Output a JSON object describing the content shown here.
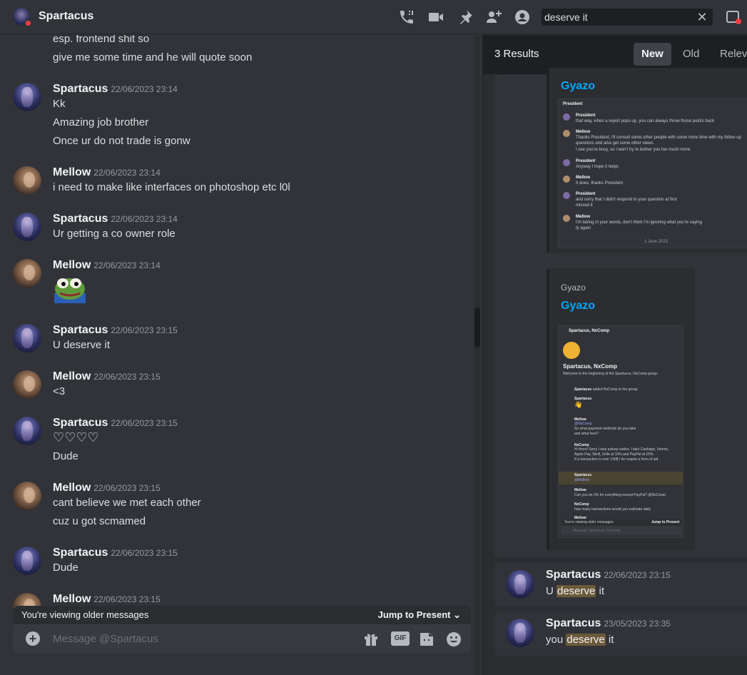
{
  "header": {
    "title": "Spartacus",
    "search_value": "deserve it",
    "clear_icon": "close-icon"
  },
  "chat": {
    "messages": [
      {
        "author": "",
        "time": "",
        "lines": [
          "esp. frontend shit so",
          "give me some time and he will quote soon"
        ]
      },
      {
        "author": "Spartacus",
        "time": "22/06/2023 23:14",
        "lines": [
          "Kk",
          "Amazing job brother",
          "Once ur do not trade is gonw"
        ]
      },
      {
        "author": "Mellow",
        "time": "22/06/2023 23:14",
        "lines": [
          "i need to make like interfaces on photoshop etc l0l"
        ]
      },
      {
        "author": "Spartacus",
        "time": "22/06/2023 23:14",
        "lines": [
          "Ur getting a co owner role"
        ]
      },
      {
        "author": "Mellow",
        "time": "22/06/2023 23:14",
        "lines": [],
        "emoji": "pepe-emoji"
      },
      {
        "author": "Spartacus",
        "time": "22/06/2023 23:15",
        "lines": [
          "U deserve it"
        ]
      },
      {
        "author": "Mellow",
        "time": "22/06/2023 23:15",
        "lines": [
          "<3"
        ]
      },
      {
        "author": "Spartacus",
        "time": "22/06/2023 23:15",
        "lines": [
          "♡♡♡♡",
          "Dude"
        ]
      },
      {
        "author": "Mellow",
        "time": "22/06/2023 23:15",
        "lines": [
          "cant believe we met each other",
          "cuz u got scmamed"
        ]
      },
      {
        "author": "Spartacus",
        "time": "22/06/2023 23:15",
        "lines": [
          "Dude"
        ]
      },
      {
        "author": "Mellow",
        "time": "22/06/2023 23:15",
        "lines": []
      }
    ],
    "older_notice": "You're viewing older messages",
    "jump_label": "Jump to Present",
    "composer_placeholder": "Message @Spartacus",
    "gif_label": "GIF"
  },
  "results": {
    "count": "3 Results",
    "tabs": [
      "New",
      "Old",
      "Relevant"
    ],
    "active_tab": "New",
    "embed1": {
      "title": "Gyazo",
      "thumb_header": "President",
      "thumb_lines": [
        {
          "name": "President",
          "text": "that way, when a report pops up, you can always throw those points back"
        },
        {
          "name": "Mellow",
          "text": "Thanks President, I'll consult some other people with some more time with my follow up"
        },
        {
          "name": "",
          "text": "questions and also get some other views."
        },
        {
          "name": "",
          "text": "I see you're busy, so I won't try to bother you too much more."
        },
        {
          "name": "President",
          "text": "Anyway I hope it helps"
        },
        {
          "name": "Mellow",
          "text": "It does, thanks President"
        },
        {
          "name": "President",
          "text": "and sorry that I didn't respond to your question at first"
        },
        {
          "name": "",
          "text": "missed it"
        },
        {
          "name": "Mellow",
          "text": "I'm taking in your words, don't think I'm ignoring what you're saying"
        },
        {
          "name": "",
          "text": "ty again"
        }
      ],
      "thumb_footer": "1 June 2023"
    },
    "embed2": {
      "provider": "Gyazo",
      "title": "Gyazo",
      "thumb_header": "Spartacus, NxComp",
      "thumb_group_title": "Spartacus, NxComp",
      "thumb_group_sub": "Welcome to the beginning of the Spartacus, NxComp group.",
      "thumb_lines": [
        {
          "name": "Spartacus",
          "text": "added NxComp to the group."
        },
        {
          "name": "Spartacus",
          "text": "👋"
        },
        {
          "name": "Mellow",
          "text": "@NxComp"
        },
        {
          "name": "",
          "text": "So what payment methods do you take"
        },
        {
          "name": "",
          "text": "and what fees?"
        },
        {
          "name": "NxComp",
          "text": "Hi there! Sorry I was asleep earlier. I take Cashapp, Venmo,"
        },
        {
          "name": "",
          "text": "Apple Pay, Skrill, Zelle at 10% and PayPal at 15%"
        },
        {
          "name": "",
          "text": "If a transaction is over 100$ I do require a form of aid"
        },
        {
          "name": "Spartacus",
          "text": "@Mellow"
        },
        {
          "name": "Mellow",
          "text": "Can you do 3% for everything except PayPal? @NxComp"
        },
        {
          "name": "NxComp",
          "text": "how many transactions would you estimate daily"
        },
        {
          "name": "Mellow",
          "text": ""
        }
      ],
      "thumb_older": "You're viewing older messages",
      "thumb_jump": "Jump to Present",
      "thumb_placeholder": "Message Spartacus, NxComp"
    },
    "result2": {
      "author": "Spartacus",
      "time": "22/06/2023 23:15",
      "before": "U ",
      "match": "deserve",
      "after": " it"
    },
    "result3": {
      "author": "Spartacus",
      "time": "23/05/2023 23:35",
      "before": "you ",
      "match": "deserve",
      "after": " it"
    }
  },
  "colors": {
    "background": "#313338",
    "panel": "#2b2d31",
    "link": "#00a8fc",
    "highlight": "#6c5a3a",
    "dnd": "#f23f43"
  }
}
